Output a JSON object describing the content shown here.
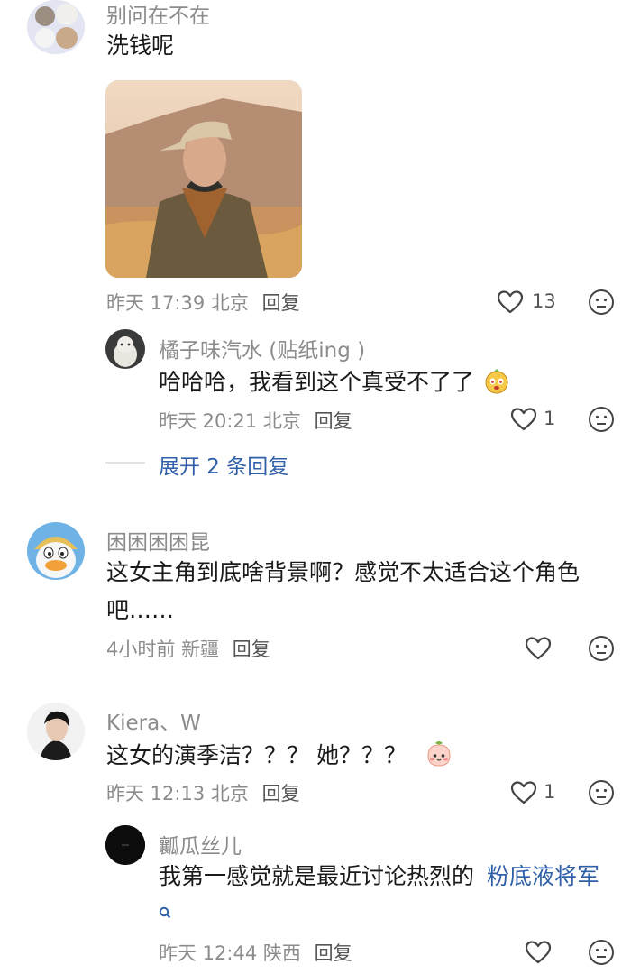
{
  "comments": [
    {
      "username": "别问在不在",
      "text": "洗钱呢",
      "time": "昨天 17:39",
      "location": "北京",
      "reply_label": "回复",
      "likes": "13",
      "replies": [
        {
          "username": "橘子味汽水 (贴纸ing )",
          "text": "哈哈哈，我看到这个真受不了了",
          "time": "昨天 20:21",
          "location": "北京",
          "reply_label": "回复",
          "likes": "1"
        }
      ],
      "expand_label": "展开 2 条回复"
    },
    {
      "username": "困困困困昆",
      "text_line1": "这女主角到底啥背景啊？感觉不太适合这个角色",
      "text_line2": "吧……",
      "time": "4小时前",
      "location": "新疆",
      "reply_label": "回复"
    },
    {
      "username": "Kiera、W",
      "text": "这女的演季洁？？？ 她？？？",
      "time": "昨天 12:13",
      "location": "北京",
      "reply_label": "回复",
      "likes": "1",
      "replies": [
        {
          "username": "瓤瓜丝儿",
          "text": "我第一感觉就是最近讨论热烈的",
          "link_text": "粉底液将军",
          "time": "昨天 12:44",
          "location": "陕西",
          "reply_label": "回复"
        }
      ]
    }
  ],
  "icons": {
    "like": "heart-outline-icon",
    "dislike": "neutral-face-icon",
    "search": "search-icon",
    "accent": "#2f5fa8"
  }
}
